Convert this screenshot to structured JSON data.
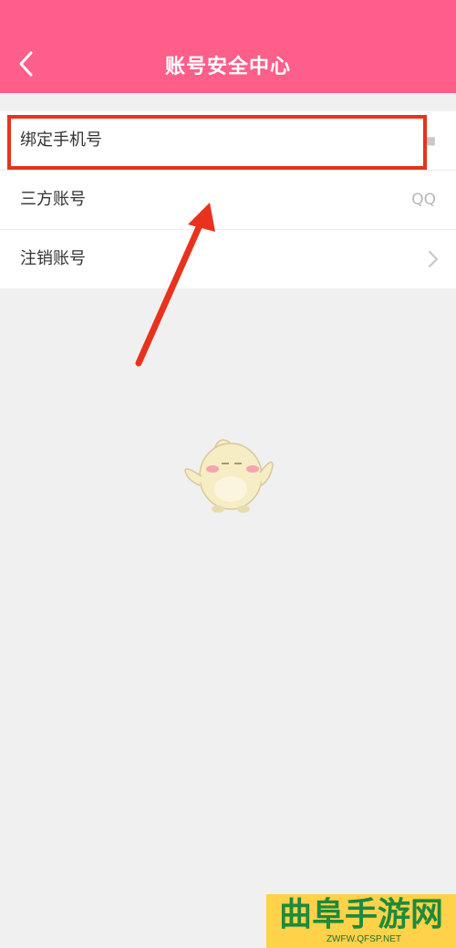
{
  "header": {
    "title": "账号安全中心",
    "back_icon": "chevron-left-icon",
    "background_color": "#fd5e8a"
  },
  "menu": {
    "items": [
      {
        "label": "绑定手机号",
        "value": "■"
      },
      {
        "label": "三方账号",
        "value": "QQ"
      },
      {
        "label": "注销账号",
        "icon": "chevron-right-icon"
      }
    ]
  },
  "annotation": {
    "highlight_color": "#e8321e"
  },
  "watermark": {
    "title": "曲阜手游网",
    "url": "ZWFW.QFSP.NET"
  }
}
